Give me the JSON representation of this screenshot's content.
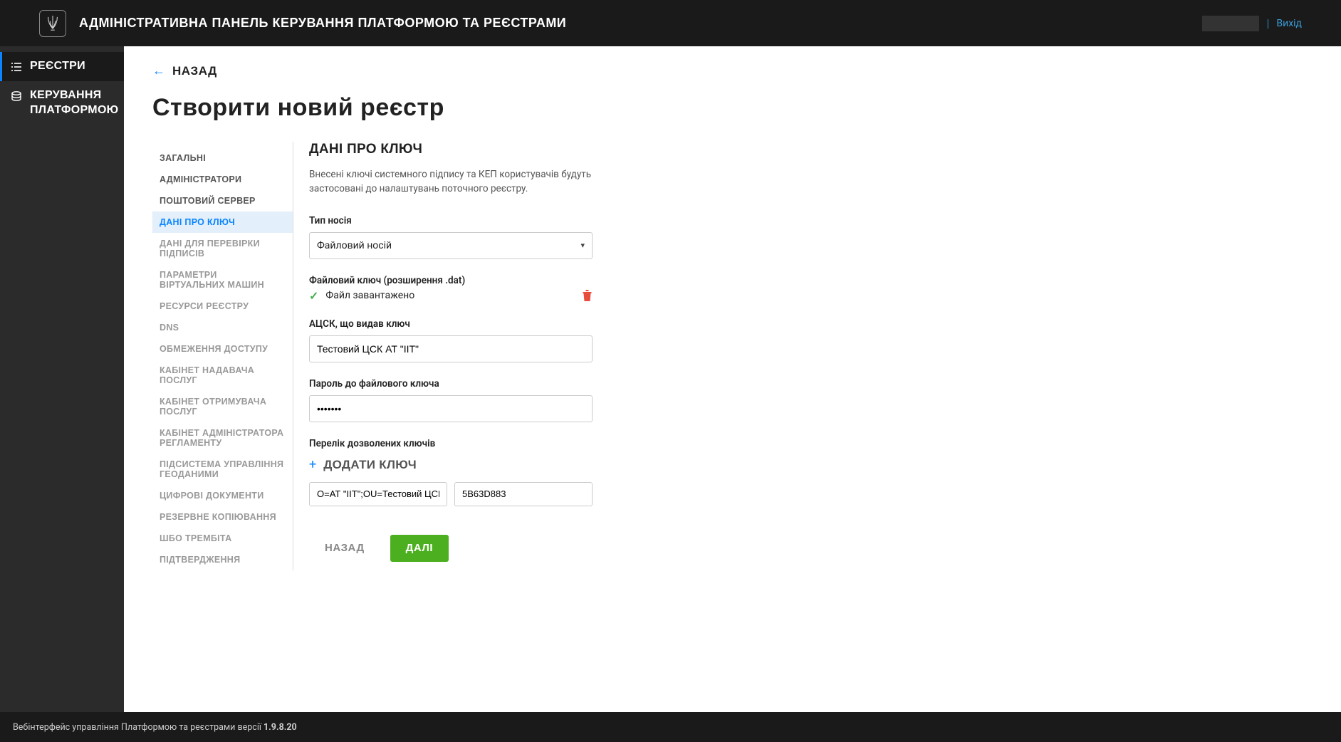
{
  "header": {
    "title": "АДМІНІСТРАТИВНА ПАНЕЛЬ КЕРУВАННЯ ПЛАТФОРМОЮ ТА РЕЄСТРАМИ",
    "logout": "Вихід",
    "divider": "|"
  },
  "sidebar": {
    "items": [
      {
        "label": "РЕЄСТРИ"
      },
      {
        "label": "КЕРУВАННЯ ПЛАТФОРМОЮ"
      }
    ]
  },
  "back": {
    "label": "НАЗАД"
  },
  "page": {
    "title": "Створити новий реєстр"
  },
  "steps": [
    {
      "label": "ЗАГАЛЬНІ",
      "state": "done"
    },
    {
      "label": "АДМІНІСТРАТОРИ",
      "state": "done"
    },
    {
      "label": "ПОШТОВИЙ СЕРВЕР",
      "state": "done"
    },
    {
      "label": "ДАНІ ПРО КЛЮЧ",
      "state": "active"
    },
    {
      "label": "ДАНІ ДЛЯ ПЕРЕВІРКИ ПІДПИСІВ",
      "state": "pending"
    },
    {
      "label": "ПАРАМЕТРИ ВІРТУАЛЬНИХ МАШИН",
      "state": "pending"
    },
    {
      "label": "РЕСУРСИ РЕЄСТРУ",
      "state": "pending"
    },
    {
      "label": "DNS",
      "state": "pending"
    },
    {
      "label": "ОБМЕЖЕННЯ ДОСТУПУ",
      "state": "pending"
    },
    {
      "label": "КАБІНЕТ НАДАВАЧА ПОСЛУГ",
      "state": "pending"
    },
    {
      "label": "КАБІНЕТ ОТРИМУВАЧА ПОСЛУГ",
      "state": "pending"
    },
    {
      "label": "КАБІНЕТ АДМІНІСТРАТОРА РЕГЛАМЕНТУ",
      "state": "pending"
    },
    {
      "label": "ПІДСИСТЕМА УПРАВЛІННЯ ГЕОДАНИМИ",
      "state": "pending"
    },
    {
      "label": "ЦИФРОВІ ДОКУМЕНТИ",
      "state": "pending"
    },
    {
      "label": "РЕЗЕРВНЕ КОПІЮВАННЯ",
      "state": "pending"
    },
    {
      "label": "ШБО ТРЕМБІТА",
      "state": "pending"
    },
    {
      "label": "ПІДТВЕРДЖЕННЯ",
      "state": "pending"
    }
  ],
  "form": {
    "section_title": "ДАНІ ПРО КЛЮЧ",
    "description": "Внесені ключі системного підпису та КЕП користувачів будуть застосовані до налаштувань поточного реєстру.",
    "media_type_label": "Тип носія",
    "media_type_value": "Файловий носій",
    "file_key_label": "Файловий ключ (розширення .dat)",
    "file_loaded_text": "Файл завантажено",
    "issuer_label": "АЦСК, що видав ключ",
    "issuer_value": "Тестовий ЦСК АТ \"ІІТ\"",
    "password_label": "Пароль до файлового ключа",
    "password_value": "•••••••",
    "allowed_keys_label": "Перелік дозволених ключів",
    "add_key_label": "ДОДАТИ КЛЮЧ",
    "key_issuer_value": "O=АТ \"ІІТ\";OU=Тестовий ЦСК",
    "key_serial_value": "5B63D883",
    "btn_back": "НАЗАД",
    "btn_next": "ДАЛІ"
  },
  "footer": {
    "text": "Вебінтерфейс управління Платформою та реєстрами версії",
    "version": "1.9.8.20"
  }
}
